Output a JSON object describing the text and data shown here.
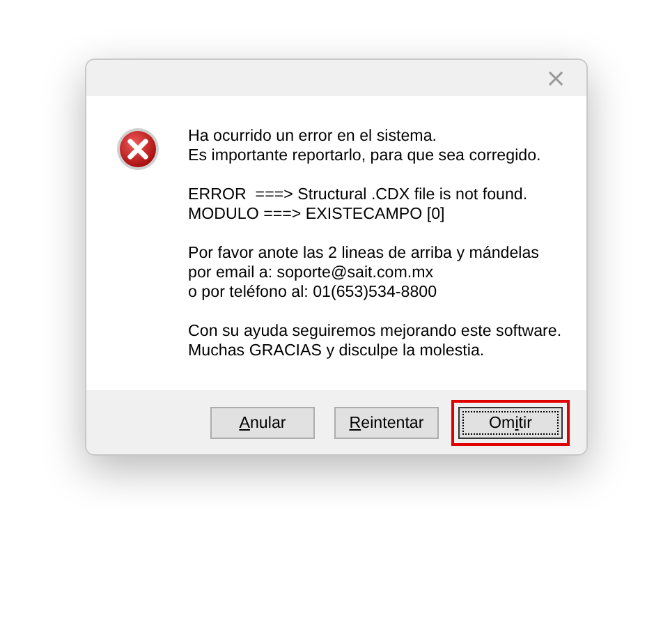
{
  "window": {
    "close_button": "×"
  },
  "message": {
    "paragraphs": [
      [
        "Ha ocurrido un error en el sistema.",
        "Es importante reportarlo, para que sea corregido."
      ],
      [
        "ERROR  ===> Structural .CDX file is not found.",
        "MODULO ===> EXISTECAMPO [0]"
      ],
      [
        "Por favor anote las 2 lineas de arriba y mándelas",
        "por email a: soporte@sait.com.mx",
        "o por teléfono al: 01(653)534-8800"
      ],
      [
        "Con su ayuda seguiremos mejorando este software.",
        "Muchas GRACIAS y disculpe la molestia."
      ]
    ]
  },
  "buttons": [
    {
      "access_key": "A",
      "rest": "nular",
      "default": false,
      "highlighted": false
    },
    {
      "access_key": "R",
      "rest": "eintentar",
      "default": false,
      "highlighted": false
    },
    {
      "prefix": "Om",
      "access_key": "i",
      "rest": "tir",
      "default": true,
      "highlighted": true
    }
  ]
}
